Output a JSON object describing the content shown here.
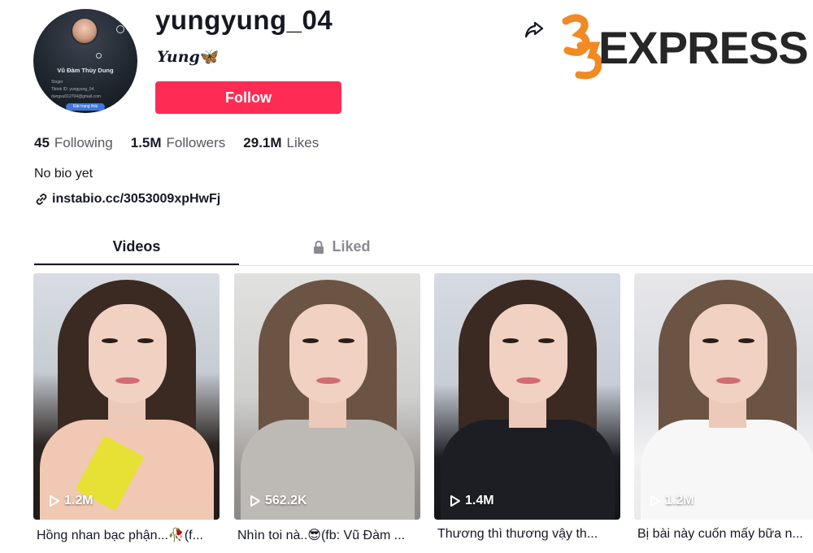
{
  "profile": {
    "username": "yungyung_04",
    "nickname": "Yung",
    "nickname_emoji": "🦋",
    "follow_label": "Follow",
    "bio": "No bio yet",
    "link": "instabio.cc/3053009xpHwFj",
    "avatar": {
      "name": "Vũ Đàm Thùy Dung",
      "line1": "Singer",
      "line2": "Tiktok ID: yungyung_04",
      "line3": "dungvu012704@gmail.com",
      "badge": "Đặt trạng thái"
    }
  },
  "stats": [
    {
      "value": "45",
      "label": "Following"
    },
    {
      "value": "1.5M",
      "label": "Followers"
    },
    {
      "value": "29.1M",
      "label": "Likes"
    }
  ],
  "tabs": {
    "videos": "Videos",
    "liked": "Liked"
  },
  "videos": [
    {
      "views": "1.2M",
      "caption": "Hồng nhan bạc phận...🥀(f..."
    },
    {
      "views": "562.2K",
      "caption": "Nhìn toi nà..😎(fb: Vũ Đàm ..."
    },
    {
      "views": "1.4M",
      "caption": "Thương thì thương vậy th..."
    },
    {
      "views": "1.2M",
      "caption": "Bị bài này cuốn mấy bữa n..."
    }
  ],
  "watermark": {
    "number": "35",
    "word": "EXPRESS"
  },
  "colors": {
    "follow": "#fe2c55",
    "text": "#161823",
    "muted": "#8a8b91",
    "brand_orange": "#f08a24"
  },
  "icons": {
    "share": "share-arrow-icon",
    "link": "link-icon",
    "lock": "lock-icon",
    "play": "play-icon"
  }
}
